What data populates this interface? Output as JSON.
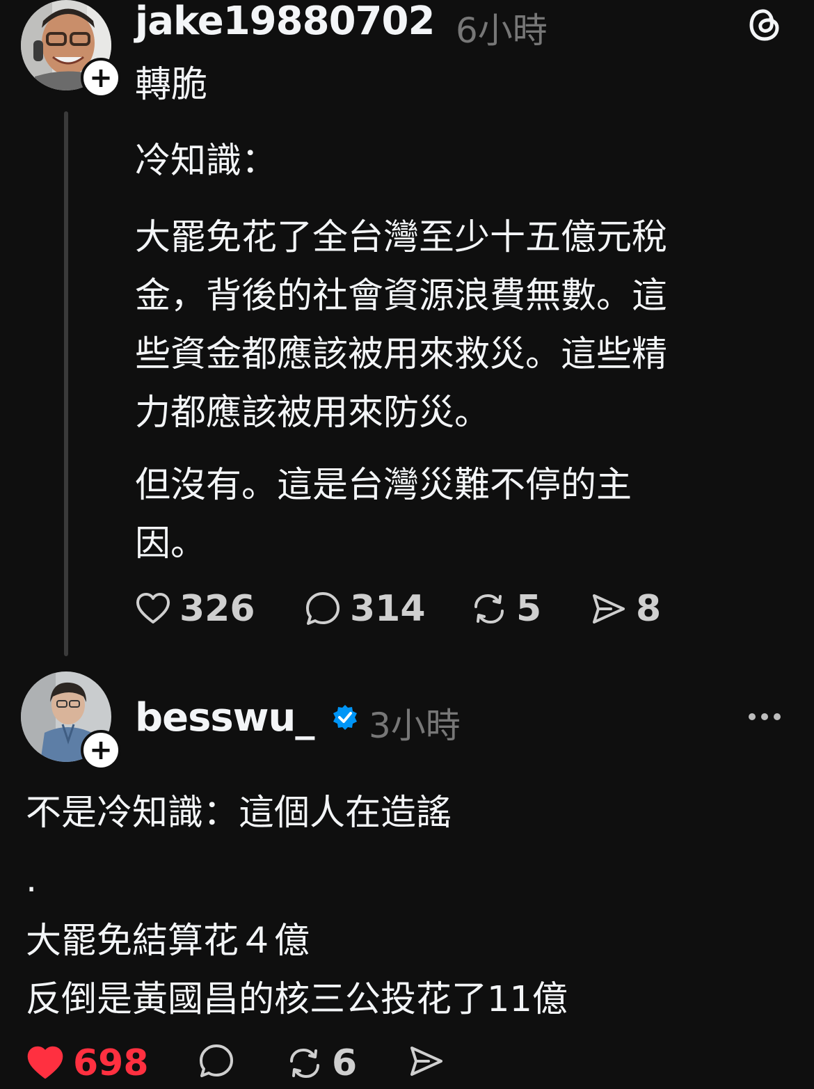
{
  "post1": {
    "username": "jake19880702",
    "time": "6小時",
    "repost_label": "轉脆",
    "quoted_lines": [
      "冷知識：",
      "大罷免花了全台灣至少十五億元稅",
      "金，背後的社會資源浪費無數。這",
      "些資金都應該被用來救災。這些精",
      "力都應該被用來防災。",
      "但沒有。這是台灣災難不停的主",
      "因。"
    ],
    "likes": "326",
    "comments": "314",
    "reposts": "5",
    "shares": "8",
    "follow_symbol": "+",
    "icons": {
      "app": "threads-logo-icon",
      "like": "heart-outline-icon",
      "comment": "comment-bubble-icon",
      "repost": "repost-icon",
      "share": "send-icon"
    }
  },
  "post2": {
    "username": "besswu_",
    "verified": true,
    "time": "3小時",
    "lines": [
      "不是冷知識：這個人在造謠",
      ".",
      "大罷免結算花４億",
      "反倒是黃國昌的核三公投花了11億"
    ],
    "likes": "698",
    "reposts": "6",
    "follow_symbol": "+",
    "icons": {
      "more": "more-options-icon",
      "verified": "verified-badge-icon",
      "like": "heart-filled-icon",
      "comment": "comment-bubble-icon",
      "repost": "repost-icon",
      "share": "send-icon"
    }
  },
  "colors": {
    "background": "#0f0f0f",
    "text": "#f3f5f7",
    "muted": "#777777",
    "like_active": "#ff3040",
    "verified": "#0095f6"
  }
}
